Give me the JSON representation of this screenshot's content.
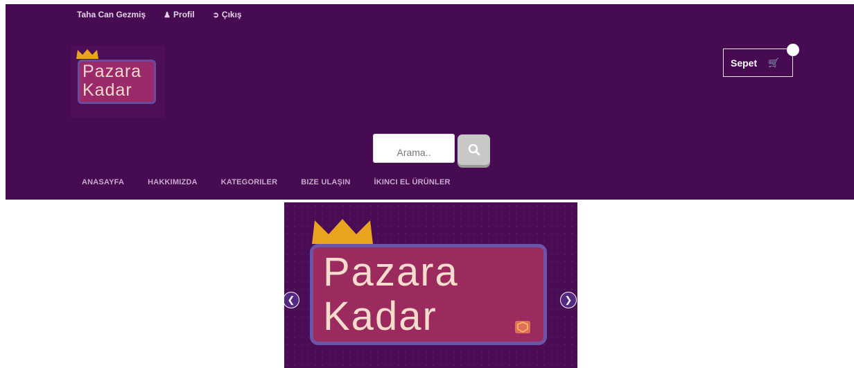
{
  "topbar": {
    "user": "Taha Can Gezmiş",
    "profile": "Profil",
    "logout": "Çıkış"
  },
  "logo": {
    "line1": "Pazara",
    "line2": "Kadar"
  },
  "cart": {
    "label": "Sepet"
  },
  "search": {
    "placeholder": "Arama.."
  },
  "nav": {
    "items": [
      "ANASAYFA",
      "HAKKIMIZDA",
      "KATEGORILER",
      "BIZE ULAŞIN",
      "İKINCI EL ÜRÜNLER"
    ]
  },
  "slider": {
    "line1": "Pazara",
    "line2": "Kadar"
  },
  "colors": {
    "header_bg": "#470b52",
    "logo_box": "#9a2a6a",
    "crown": "#e8a41f"
  }
}
